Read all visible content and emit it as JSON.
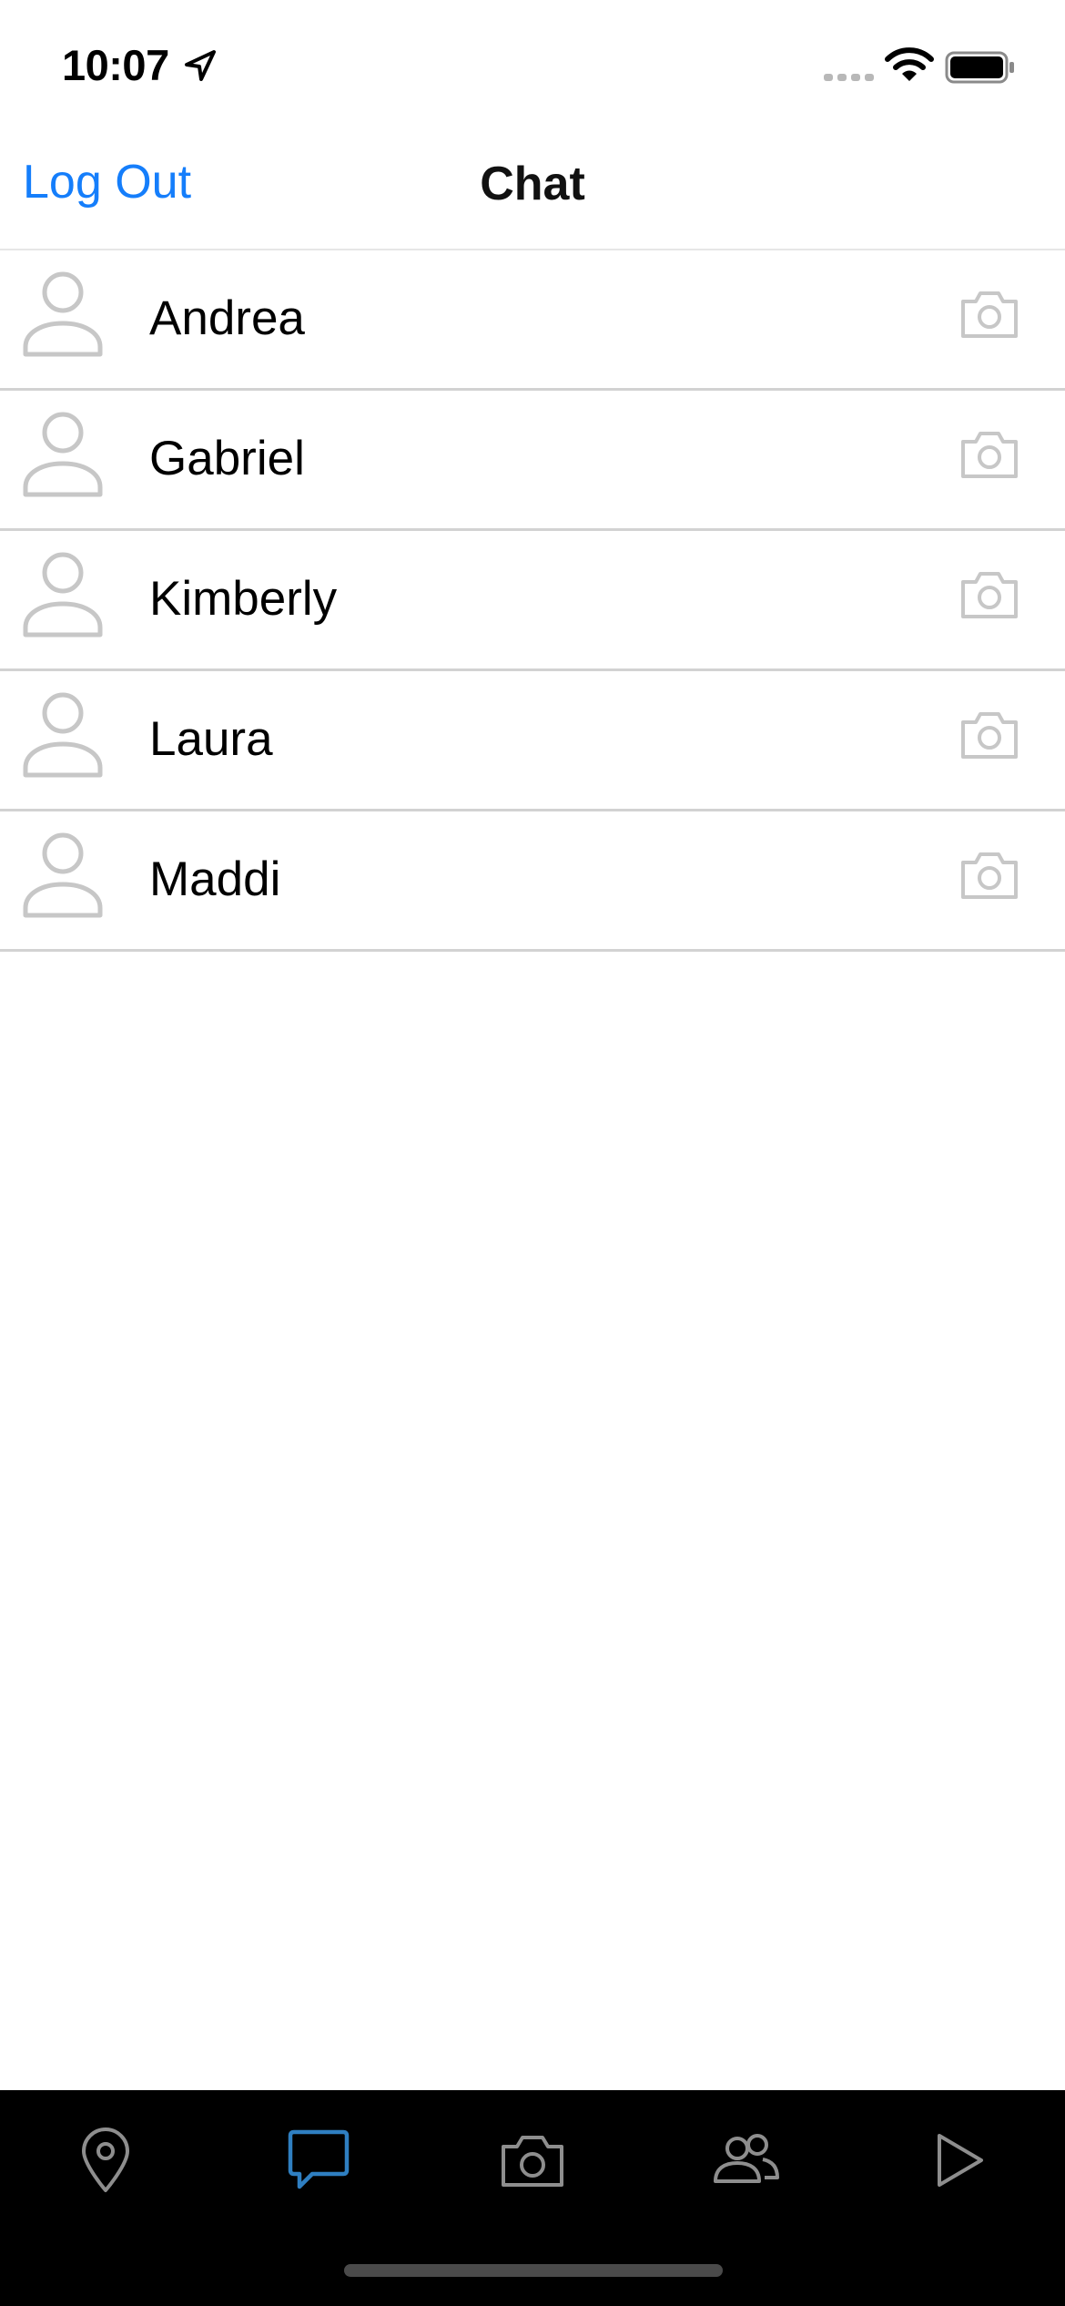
{
  "status_bar": {
    "time": "10:07",
    "icons": [
      "location-arrow-icon",
      "signal-dots-icon",
      "wifi-icon",
      "battery-icon"
    ]
  },
  "nav": {
    "left_button": "Log Out",
    "title": "Chat"
  },
  "contacts": [
    {
      "name": "Andrea",
      "avatar_icon": "person-icon",
      "action_icon": "camera-icon"
    },
    {
      "name": "Gabriel",
      "avatar_icon": "person-icon",
      "action_icon": "camera-icon"
    },
    {
      "name": "Kimberly",
      "avatar_icon": "person-icon",
      "action_icon": "camera-icon"
    },
    {
      "name": "Laura",
      "avatar_icon": "person-icon",
      "action_icon": "camera-icon"
    },
    {
      "name": "Maddi",
      "avatar_icon": "person-icon",
      "action_icon": "camera-icon"
    }
  ],
  "tab_bar": {
    "tabs": [
      {
        "icon": "map-pin-icon",
        "active": false
      },
      {
        "icon": "chat-bubble-icon",
        "active": true
      },
      {
        "icon": "camera-icon",
        "active": false
      },
      {
        "icon": "friends-icon",
        "active": false
      },
      {
        "icon": "play-icon",
        "active": false
      }
    ],
    "active_color": "#2f7fc1",
    "inactive_color": "#8e8e8e"
  },
  "colors": {
    "accent": "#157efb",
    "separator": "#d2d2d2",
    "icon_gray": "#c7c7c7"
  }
}
